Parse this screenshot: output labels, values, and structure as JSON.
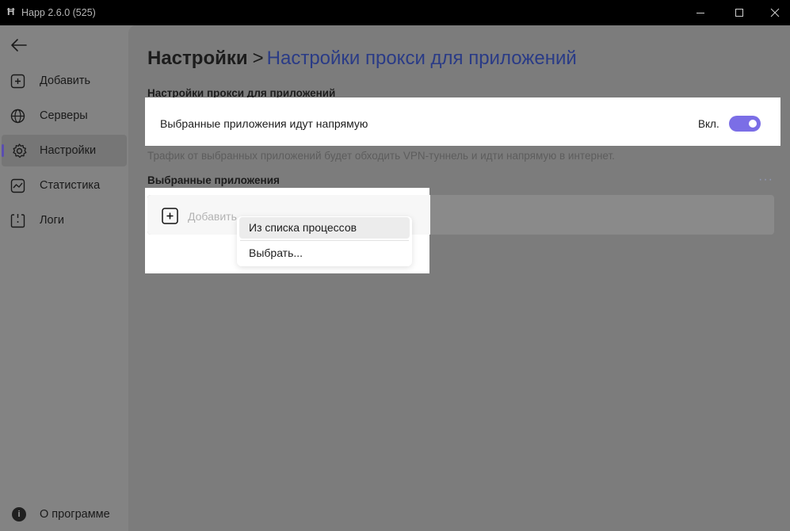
{
  "window": {
    "title": "Happ 2.6.0 (525)",
    "logo": "Ħ"
  },
  "sidebar": {
    "items": [
      {
        "label": "Добавить",
        "icon": "plus-square-icon"
      },
      {
        "label": "Серверы",
        "icon": "globe-icon"
      },
      {
        "label": "Настройки",
        "icon": "gear-icon",
        "active": true
      },
      {
        "label": "Статистика",
        "icon": "chart-icon"
      },
      {
        "label": "Логи",
        "icon": "logs-icon"
      }
    ],
    "about": {
      "label": "О программе",
      "icon_text": "i"
    }
  },
  "main": {
    "breadcrumb": {
      "root": "Настройки",
      "separator": ">",
      "current": "Настройки прокси для приложений"
    },
    "proxy_section": {
      "title": "Настройки прокси для приложений",
      "row_label": "Выбранные приложения идут напрямую",
      "state_label": "Вкл.",
      "toggle_on": true,
      "hint": "Трафик от выбранных приложений будет обходить VPN-туннель и идти напрямую в интернет."
    },
    "apps_section": {
      "title": "Выбранные приложения",
      "more": "···",
      "add_label": "Добавить"
    },
    "context_menu": {
      "items": [
        "Из списка процессов",
        "Выбрать..."
      ]
    }
  },
  "colors": {
    "accent": "#7b6ee6",
    "breadcrumb_current": "#2a3b86",
    "indicator": "#5a4db0"
  }
}
